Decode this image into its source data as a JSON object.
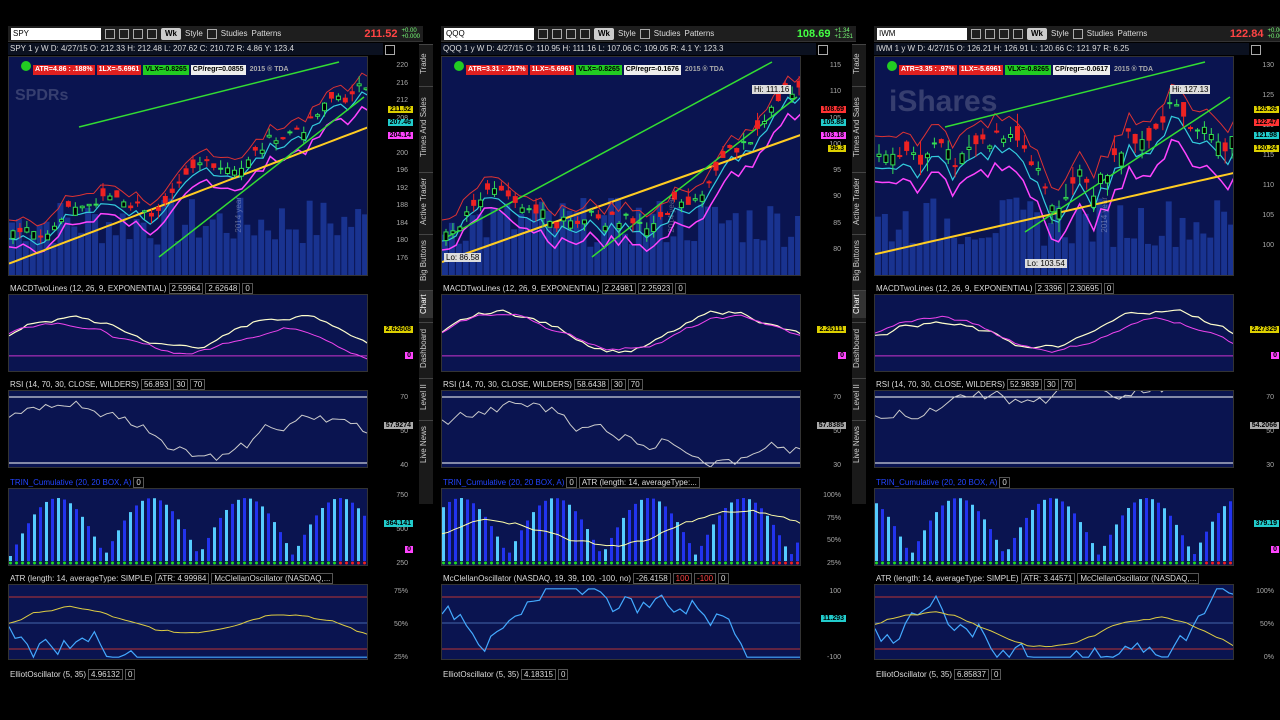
{
  "panels": [
    {
      "symbol": "SPY",
      "price": "211.52",
      "price_color": "#ff4444",
      "change_top": "+0.00",
      "change_bottom": "+0.000",
      "info": "SPY 1 y W   D: 4/27/15   O: 212.33   H: 212.48   L: 207.62   C: 210.72   R: 4.86   Y: 123.4",
      "tags": [
        {
          "text": "ATR=4.86 : .188%",
          "bg": "#e02020",
          "fg": "#fff"
        },
        {
          "text": "1LX=-5.6961",
          "bg": "#e02020",
          "fg": "#fff"
        },
        {
          "text": "VLX=-0.8265",
          "bg": "#22cc22",
          "fg": "#000"
        },
        {
          "text": "CP/regr=0.0855",
          "bg": "#eee",
          "fg": "#000"
        },
        {
          "text": "2015 ® TDA",
          "bg": "transparent",
          "fg": "#aaa"
        }
      ],
      "watermark": "SPDRs",
      "year_label": "2014 year",
      "yticks": [
        "220",
        "216",
        "212",
        "208",
        "204",
        "200",
        "196",
        "192",
        "188",
        "184",
        "180",
        "176"
      ],
      "price_labels": [
        {
          "text": "211.52",
          "bg": "#ddd000"
        },
        {
          "text": "207.46",
          "bg": "#22cccc"
        },
        {
          "text": "204.14",
          "bg": "#ff44ff"
        }
      ],
      "macd_title": "MACDTwoLines (12, 26, 9, EXPONENTIAL)",
      "macd_vals": [
        "2.59964",
        "2.62648",
        "0"
      ],
      "macd_label": "2.62608",
      "macd_zero": "0",
      "rsi_title": "RSI (14, 70, 30, CLOSE, WILDERS)",
      "rsi_vals": [
        "56.893",
        "30",
        "70"
      ],
      "rsi_label": "57.9274",
      "rsi_ticks": [
        "70",
        "50",
        "40"
      ],
      "vol_title": "TRIN_Cumulative (20, 20 BOX, A)",
      "vol_vals": [
        "0"
      ],
      "vol_ticks": [
        "750",
        "500",
        "250"
      ],
      "vol_label": "364.141",
      "vol_zero": "0",
      "atr_title": "ATR (length: 14, averageType: SIMPLE)",
      "atr_vals": [
        "ATR: 4.99984",
        "McClellanOscillator (NASDAQ,..."
      ],
      "atr_ticks": [
        "75%",
        "50%",
        "25%"
      ],
      "ell_title": "ElliotOscillator (5, 35)",
      "ell_vals": [
        "4.96132",
        "0"
      ]
    },
    {
      "symbol": "QQQ",
      "price": "108.69",
      "price_color": "#44ff44",
      "change_top": "+1.34",
      "change_bottom": "+1.251",
      "info": "QQQ 1 y W   D: 4/27/15   O: 110.95   H: 111.16   L: 107.06   C: 109.05   R: 4.1   Y: 123.3",
      "tags": [
        {
          "text": "ATR=3.31 : .217%",
          "bg": "#e02020",
          "fg": "#fff"
        },
        {
          "text": "1LX=-5.6961",
          "bg": "#e02020",
          "fg": "#fff"
        },
        {
          "text": "VLX=-0.8265",
          "bg": "#22cc22",
          "fg": "#000"
        },
        {
          "text": "CP/regr=-0.1676",
          "bg": "#eee",
          "fg": "#000"
        },
        {
          "text": "2015 ® TDA",
          "bg": "transparent",
          "fg": "#aaa"
        }
      ],
      "watermark": "",
      "year_label": "2014 year",
      "hi_label": "Hi: 111.16",
      "lo_label": "Lo: 86.58",
      "yticks": [
        "115",
        "110",
        "105",
        "100",
        "95",
        "90",
        "85",
        "80"
      ],
      "price_labels": [
        {
          "text": "108.69",
          "bg": "#ff3333"
        },
        {
          "text": "105.88",
          "bg": "#22cccc"
        },
        {
          "text": "103.18",
          "bg": "#ff44ff"
        },
        {
          "text": "96.3",
          "bg": "#ddd000"
        }
      ],
      "macd_title": "MACDTwoLines (12, 26, 9, EXPONENTIAL)",
      "macd_vals": [
        "2.24981",
        "2.25923",
        "0"
      ],
      "macd_label": "2.25111",
      "macd_zero": "0",
      "rsi_title": "RSI (14, 70, 30, CLOSE, WILDERS)",
      "rsi_vals": [
        "58.6438",
        "30",
        "70"
      ],
      "rsi_label": "57.8385",
      "rsi_ticks": [
        "70",
        "50",
        "30"
      ],
      "vol_title": "TRIN_Cumulative (20, 20 BOX, A)",
      "vol_vals": [
        "0",
        "ATR (length: 14, averageType:..."
      ],
      "vol_ticks": [
        "100%",
        "75%",
        "50%",
        "25%"
      ],
      "vol_label": "",
      "vol_zero": "",
      "atr_title": "McClellanOscillator (NASDAQ, 19, 39, 100, -100, no)",
      "atr_vals": [
        "-26.4158",
        "100",
        "-100",
        "0"
      ],
      "atr_ticks": [
        "100",
        "-100"
      ],
      "atr_label": "11.293",
      "ell_title": "ElliotOscillator (5, 35)",
      "ell_vals": [
        "4.18315",
        "0"
      ]
    },
    {
      "symbol": "IWM",
      "price": "122.84",
      "price_color": "#ff4444",
      "change_top": "+0.00",
      "change_bottom": "+0.000",
      "info": "IWM 1 y W   D: 4/27/15   O: 126.21   H: 126.91   L: 120.66   C: 121.97   R: 6.25",
      "tags": [
        {
          "text": "ATR=3.35 : .97%",
          "bg": "#e02020",
          "fg": "#fff"
        },
        {
          "text": "1LX=-5.6961",
          "bg": "#e02020",
          "fg": "#fff"
        },
        {
          "text": "VLX=-0.8265",
          "bg": "#22cc22",
          "fg": "#000"
        },
        {
          "text": "CP/regr=-0.0617",
          "bg": "#eee",
          "fg": "#000"
        },
        {
          "text": "2015 ® TDA",
          "bg": "transparent",
          "fg": "#aaa"
        }
      ],
      "watermark": "iShares",
      "year_label": "2014 year",
      "hi_label": "Hi: 127.13",
      "lo_label": "Lo: 103.54",
      "yticks": [
        "130",
        "125",
        "120",
        "115",
        "110",
        "105",
        "100"
      ],
      "price_labels": [
        {
          "text": "125.26",
          "bg": "#ddd000"
        },
        {
          "text": "122.47",
          "bg": "#ff3333"
        },
        {
          "text": "121.98",
          "bg": "#22cccc"
        },
        {
          "text": "120.24",
          "bg": "#ddd000"
        }
      ],
      "macd_title": "MACDTwoLines (12, 26, 9, EXPONENTIAL)",
      "macd_vals": [
        "2.3396",
        "2.30695",
        "0"
      ],
      "macd_label": "2.27329",
      "macd_zero": "0",
      "rsi_title": "RSI (14, 70, 30, CLOSE, WILDERS)",
      "rsi_vals": [
        "52.9839",
        "30",
        "70"
      ],
      "rsi_label": "54.2066",
      "rsi_ticks": [
        "70",
        "50",
        "30"
      ],
      "vol_title": "TRIN_Cumulative (20, 20 BOX, A)",
      "vol_vals": [
        "0"
      ],
      "vol_ticks": [],
      "vol_label": "379.19",
      "vol_zero": "0",
      "atr_title": "ATR (length: 14, averageType: SIMPLE)",
      "atr_vals": [
        "ATR: 3.44571",
        "McClellanOscillator (NASDAQ,..."
      ],
      "atr_ticks": [
        "100%",
        "50%",
        "0%"
      ],
      "ell_title": "ElliotOscillator (5, 35)",
      "ell_vals": [
        "6.85837",
        "0"
      ]
    }
  ],
  "toolbar": {
    "wk": "Wk",
    "style": "Style",
    "studies": "Studies",
    "patterns": "Patterns"
  },
  "sidetabs": [
    "Trade",
    "Times And Sales",
    "Active Trader",
    "Big Buttons",
    "Chart",
    "Dashboard",
    "Level II",
    "Live News"
  ]
}
